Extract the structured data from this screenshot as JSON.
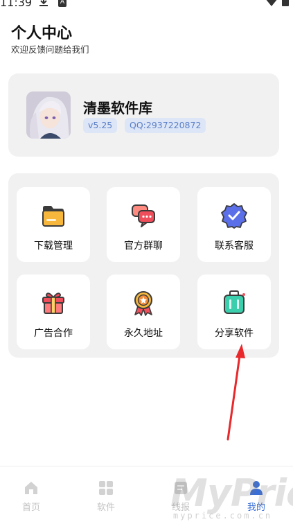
{
  "status_bar": {
    "time": "11:39",
    "a_glyph": "A"
  },
  "header": {
    "title": "个人中心",
    "subtitle": "欢迎反馈问题给我们"
  },
  "profile": {
    "app_name": "清墨软件库",
    "version": "v5.25",
    "qq": "QQ:2937220872"
  },
  "menu": {
    "items": [
      {
        "label": "下载管理",
        "icon": "folder-icon"
      },
      {
        "label": "官方群聊",
        "icon": "chat-bubbles-icon"
      },
      {
        "label": "联系客服",
        "icon": "verified-badge-icon"
      },
      {
        "label": "广告合作",
        "icon": "gift-icon"
      },
      {
        "label": "永久地址",
        "icon": "medal-icon"
      },
      {
        "label": "分享软件",
        "icon": "suitcase-icon"
      }
    ]
  },
  "tabbar": {
    "tabs": [
      {
        "label": "首页",
        "icon": "home-icon",
        "active": false
      },
      {
        "label": "软件",
        "icon": "grid-icon",
        "active": false
      },
      {
        "label": "线报",
        "icon": "news-icon",
        "active": false
      },
      {
        "label": "我的",
        "icon": "person-icon",
        "active": true
      }
    ]
  },
  "watermark": {
    "text": "MyPrice",
    "subtext": "myprice.com.cn"
  },
  "colors": {
    "accent": "#3a6fd8",
    "badge_bg": "#dde6f7",
    "badge_text": "#5b7fc7",
    "card_bg": "#f1f1f1",
    "arrow": "#e8282b"
  }
}
